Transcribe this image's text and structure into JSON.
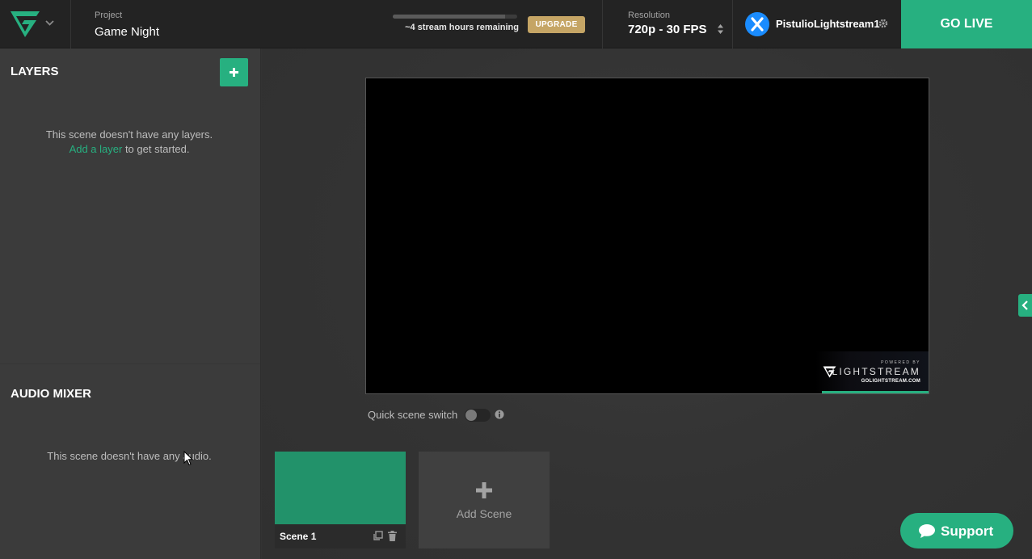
{
  "header": {
    "project_label": "Project",
    "project_name": "Game Night",
    "stream_hours": "~4 stream hours remaining",
    "stream_hours_fraction": 0.9,
    "upgrade_label": "UPGRADE",
    "resolution_label": "Resolution",
    "resolution_value": "720p - 30 FPS",
    "username": "PistulioLightstream1",
    "go_live_label": "GO LIVE"
  },
  "sidebar": {
    "layers_title": "LAYERS",
    "layers_empty_text": "This scene doesn't have any layers.",
    "layers_add_link": "Add a layer",
    "layers_add_suffix": " to get started.",
    "audio_title": "AUDIO MIXER",
    "audio_empty_text": "This scene doesn't have any audio."
  },
  "preview": {
    "watermark_powered": "POWERED BY",
    "watermark_brand": "LIGHTSTREAM",
    "watermark_url": "GOLIGHTSTREAM.COM"
  },
  "controls": {
    "quick_scene_switch_label": "Quick scene switch",
    "quick_scene_switch_on": false
  },
  "scenes": {
    "items": [
      {
        "name": "Scene 1",
        "thumb_color": "#22926a"
      }
    ],
    "add_label": "Add Scene"
  },
  "support": {
    "label": "Support"
  },
  "colors": {
    "accent": "#27b080",
    "upgrade": "#c5a565",
    "topbar": "#232323",
    "sidebar": "#3b3b3b",
    "main": "#333333"
  }
}
